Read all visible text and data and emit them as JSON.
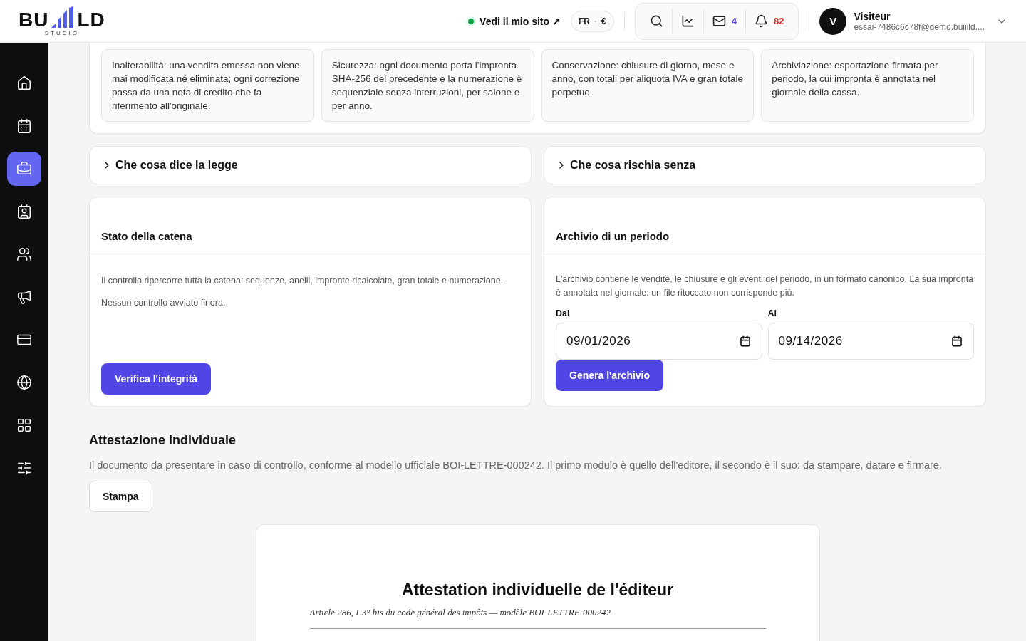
{
  "logo": {
    "left": "BU",
    "right": "LD",
    "sub": "STUDIO"
  },
  "header": {
    "site_link": "Vedi il mio sito ↗",
    "site_online": true,
    "lang": "FR",
    "separator": "·",
    "currency": "€",
    "messages": "4",
    "notifications": "82",
    "user": {
      "initial": "V",
      "name": "Visiteur",
      "email": "essai-7486c6c78f@demo.buiiild...."
    }
  },
  "sidebar": {
    "items": [
      {
        "selected": false
      },
      {
        "selected": false
      },
      {
        "selected": true
      },
      {
        "selected": false
      },
      {
        "selected": false
      },
      {
        "selected": false
      },
      {
        "selected": false
      },
      {
        "selected": false
      },
      {
        "selected": false
      },
      {
        "selected": false
      }
    ]
  },
  "principles": [
    "Inalterabilità: una vendita emessa non viene mai modificata né eliminata; ogni correzione passa da una nota di credito che fa riferimento all'originale.",
    "Sicurezza: ogni documento porta l'impronta SHA-256 del precedente e la numerazione è sequenziale senza interruzioni, per salone e per anno.",
    "Conservazione: chiusure di giorno, mese e anno, con totali per aliquota IVA e gran totale perpetuo.",
    "Archiviazione: esportazione firmata per periodo, la cui impronta è annotata nel giornale della cassa."
  ],
  "collapsibles": [
    {
      "title": "Che cosa dice la legge",
      "expanded": false
    },
    {
      "title": "Che cosa rischia senza",
      "expanded": false
    }
  ],
  "chain": {
    "title": "Stato della catena",
    "text": "Il controllo ripercorre tutta la catena: sequenze, anelli, impronte ricalcolate, gran totale e numerazione.",
    "status": "Nessun controllo avviato finora.",
    "button": "Verifica l'integrità"
  },
  "archive": {
    "title": "Archivio di un periodo",
    "text": "L'archivio contiene le vendite, le chiusure e gli eventi del periodo, in un formato canonico. La sua impronta è annotata nel giornale: un file ritoccato non corrisponde più.",
    "fields": [
      {
        "label": "Dal",
        "value": "09/01/2026"
      },
      {
        "label": "Al",
        "value": "09/14/2026"
      }
    ],
    "button": "Genera l'archivio"
  },
  "attestation": {
    "title": "Attestazione individuale",
    "text": "Il documento da presentare in caso di controllo, conforme al modello ufficiale BOI-LETTRE-000242. Il primo modulo è quello dell'editore, il secondo è il suo: da stampare, datare e firmare.",
    "button": "Stampa",
    "document": {
      "title": "Attestation individuelle de l'éditeur",
      "subtitle": "Article 286, I-3° bis du code général des impôts — modèle BOI-LETTRE-000242"
    }
  }
}
